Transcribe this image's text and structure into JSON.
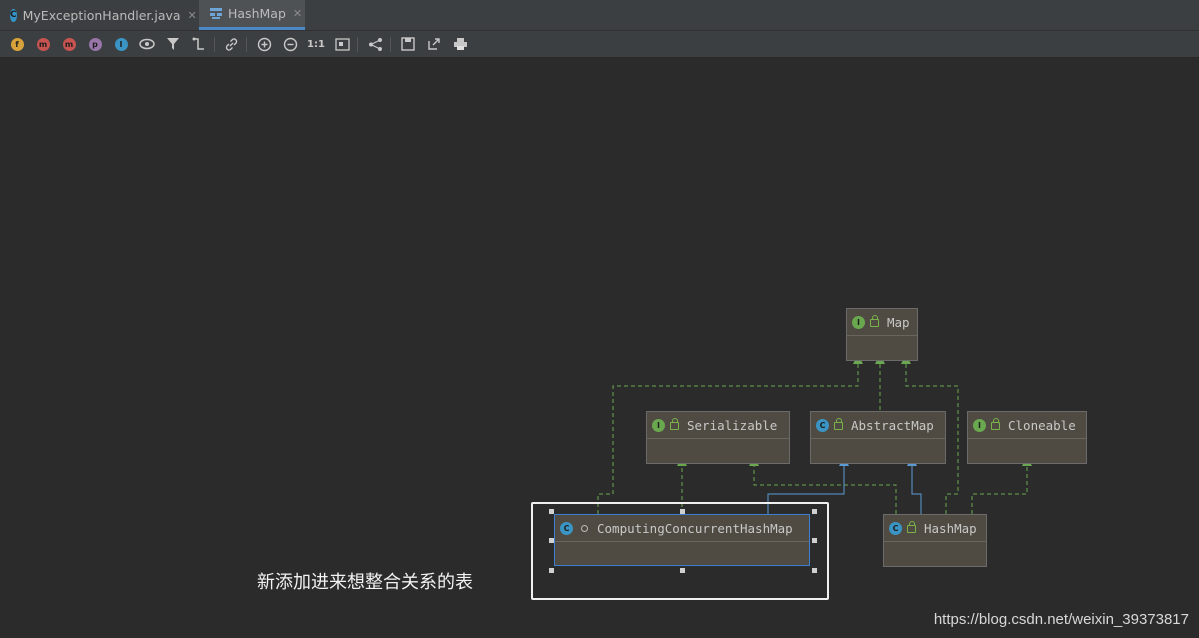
{
  "tabs": [
    {
      "label": "MyExceptionHandler.java",
      "icon": "class-c-icon",
      "active": false
    },
    {
      "label": "HashMap",
      "icon": "diagram-icon",
      "active": true
    }
  ],
  "toolbar": {
    "icons": [
      "fields-f-icon",
      "constructors-icon",
      "methods-m-icon",
      "properties-p-icon",
      "inner-classes-icon",
      "visibility-eye-icon",
      "filter-icon",
      "edge-route-icon",
      "link-icon",
      "zoom-in-icon",
      "zoom-out-icon",
      "actual-size-icon",
      "fit-content-icon",
      "layout-icon",
      "save-icon",
      "export-icon",
      "print-icon"
    ],
    "actual_size_label": "1:1"
  },
  "diagram": {
    "nodes": {
      "map": {
        "label": "Map",
        "kind": "interface"
      },
      "serializable": {
        "label": "Serializable",
        "kind": "interface"
      },
      "abstractmap": {
        "label": "AbstractMap",
        "kind": "abstract-class"
      },
      "cloneable": {
        "label": "Cloneable",
        "kind": "interface"
      },
      "computing": {
        "label": "ComputingConcurrentHashMap",
        "kind": "class"
      },
      "hashmap": {
        "label": "HashMap",
        "kind": "class"
      }
    },
    "colors": {
      "implements": "#6aa84f",
      "extends": "#5b9bd5",
      "node_bg": "#4f4b42",
      "selection": "#3d7fd1"
    }
  },
  "annotation": {
    "text": "新添加进来想整合关系的表"
  },
  "watermark": "https://blog.csdn.net/weixin_39373817"
}
